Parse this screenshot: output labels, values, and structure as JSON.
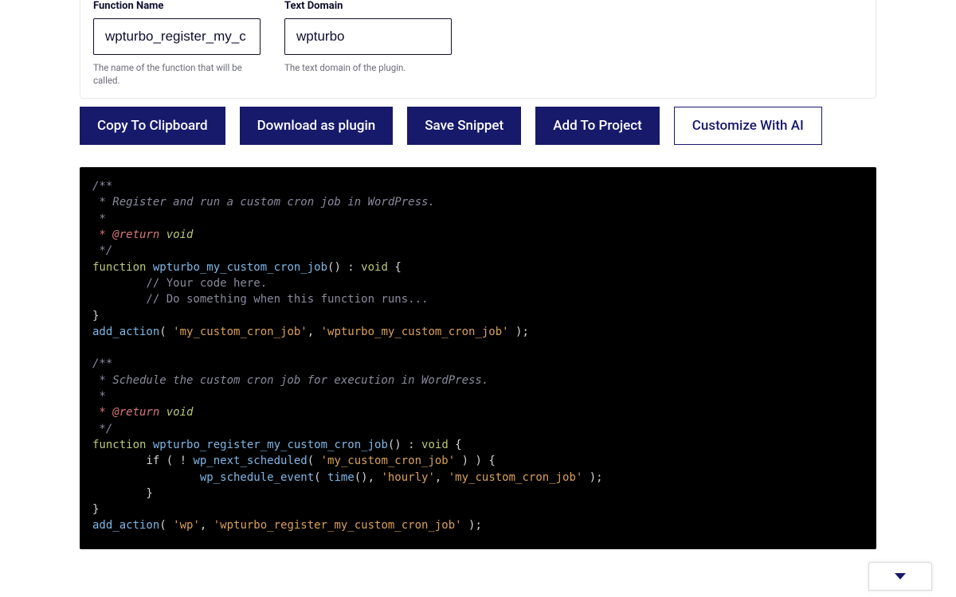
{
  "form": {
    "function_name": {
      "label": "Function Name",
      "value": "wpturbo_register_my_c",
      "help": "The name of the function that will be called."
    },
    "text_domain": {
      "label": "Text Domain",
      "value": "wpturbo",
      "help": "The text domain of the plugin."
    }
  },
  "buttons": {
    "copy": "Copy To Clipboard",
    "download": "Download as plugin",
    "save": "Save Snippet",
    "add": "Add To Project",
    "customize": "Customize With AI"
  },
  "code": {
    "doc1_l1": "/**",
    "doc1_l2": " * Register and run a custom cron job in WordPress.",
    "doc1_l3": " *",
    "doc1_ret_tag": " * @return",
    "doc1_ret_type": " void",
    "doc1_l5": " */",
    "fn_kw": "function",
    "fn1_name": " wpturbo_my_custom_cron_job",
    "fn1_sig": "() : ",
    "void_kw": "void",
    "brace_open": " {",
    "fn1_c1": "        // Your code here.",
    "fn1_c2": "        // Do something when this function runs...",
    "brace_close": "}",
    "add_action": "add_action",
    "paren_open": "( ",
    "hook1_a": "'my_custom_cron_job'",
    "sep": ", ",
    "hook1_b": "'wpturbo_my_custom_cron_job'",
    "paren_close": " );",
    "doc2_l1": "/**",
    "doc2_l2": " * Schedule the custom cron job for execution in WordPress.",
    "doc2_l3": " *",
    "doc2_l5": " */",
    "fn2_name": " wpturbo_register_my_custom_cron_job",
    "if_line_a": "        if ( ! ",
    "wp_next": "wp_next_scheduled",
    "if_line_b": "( ",
    "if_str": "'my_custom_cron_job'",
    "if_line_c": " ) ) {",
    "sched_indent": "                ",
    "wp_sched": "wp_schedule_event",
    "sched_args_a": "( ",
    "time_fn": "time",
    "sched_args_b": "(), ",
    "hourly": "'hourly'",
    "sched_args_c": ", ",
    "sched_str": "'my_custom_cron_job'",
    "sched_args_d": " );",
    "if_close": "        }",
    "hook2_a": "'wp'",
    "hook2_b": "'wpturbo_register_my_custom_cron_job'"
  }
}
